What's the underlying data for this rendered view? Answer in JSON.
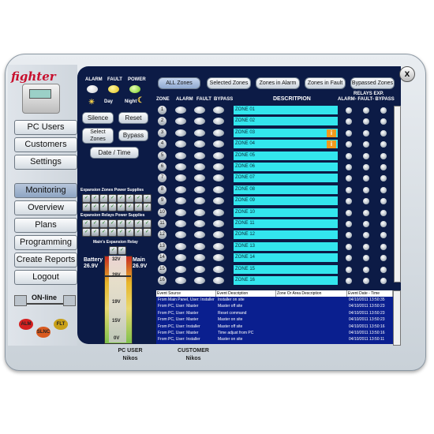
{
  "app": {
    "brand": "fighter",
    "close_label": "x"
  },
  "nav": {
    "items": [
      {
        "label": "PC Users",
        "active": false
      },
      {
        "label": "Customers",
        "active": false
      },
      {
        "label": "Settings",
        "active": false
      },
      {
        "label": "Monitoring",
        "active": true
      },
      {
        "label": "Overview",
        "active": false
      },
      {
        "label": "Plans",
        "active": false
      },
      {
        "label": "Programming",
        "active": false
      },
      {
        "label": "Create Reports",
        "active": false
      },
      {
        "label": "Logout",
        "active": false
      }
    ],
    "online_label": "ON-line"
  },
  "indicators": {
    "alarm": "ALARM",
    "fault": "FAULT",
    "power": "POWER",
    "day": "Day",
    "night": "Night"
  },
  "indicator_colors": {
    "alarm": "#e7e9ee",
    "fault": "#f2d31c",
    "power": "#8cde2c"
  },
  "controls": {
    "silence": "Silence",
    "reset": "Reset",
    "select_zones": "Select Zones",
    "bypass": "Bypass",
    "date_time": "Date / Time"
  },
  "expansion": {
    "zones_label": "Expansion Zones Power Supplies",
    "relays_label": "Expansion Relays Power Supplies",
    "mains_label": "Main's Expansion Relay"
  },
  "battery": {
    "label": "Battery",
    "value": "26.9V"
  },
  "mains": {
    "label": "Main",
    "value": "26.9V"
  },
  "gauge_ticks": [
    "32V",
    "28V",
    "19V",
    "15V",
    "0V"
  ],
  "filters": [
    {
      "label": "ALL Zones",
      "selected": true
    },
    {
      "label": "Selected Zones",
      "selected": false
    },
    {
      "label": "Zones in Alarm",
      "selected": false
    },
    {
      "label": "Zones in Fault",
      "selected": false
    },
    {
      "label": "Bypassed Zones",
      "selected": false
    }
  ],
  "zone_headers": {
    "zone": "ZONE",
    "alarm": "ALARM",
    "fault": "FAULT",
    "bypass": "BYPASS",
    "description": "DESCRITPION",
    "relays_exp": "RELAYS EXP.",
    "relay_cols": "ALARM- FAULT- BYPASS"
  },
  "zones": [
    {
      "num": "1",
      "desc": "ZONE 01",
      "warn": false
    },
    {
      "num": "2",
      "desc": "ZONE 02",
      "warn": false
    },
    {
      "num": "3",
      "desc": "ZONE 03",
      "warn": true
    },
    {
      "num": "4",
      "desc": "ZONE 04",
      "warn": true
    },
    {
      "num": "5",
      "desc": "ZONE 05",
      "warn": false
    },
    {
      "num": "6",
      "desc": "ZONE 06",
      "warn": false
    },
    {
      "num": "7",
      "desc": "ZONE 07",
      "warn": false
    },
    {
      "num": "8",
      "desc": "ZONE 08",
      "warn": false
    },
    {
      "num": "9",
      "desc": "ZONE 09",
      "warn": false
    },
    {
      "num": "10",
      "desc": "ZONE 10",
      "warn": false
    },
    {
      "num": "11",
      "desc": "ZONE 11",
      "warn": false
    },
    {
      "num": "12",
      "desc": "ZONE 12",
      "warn": false
    },
    {
      "num": "13",
      "desc": "ZONE 13",
      "warn": false
    },
    {
      "num": "14",
      "desc": "ZONE 14",
      "warn": false
    },
    {
      "num": "15",
      "desc": "ZONE 15",
      "warn": false
    },
    {
      "num": "16",
      "desc": "ZONE 16",
      "warn": false
    }
  ],
  "warn_glyph": "i",
  "log": {
    "headers": [
      "Event Source",
      "Event Description",
      "Zone Or Area Description",
      "Event Date - Time"
    ],
    "rows": [
      [
        "From Main Panel, User: Installer",
        "Installer on site",
        "",
        "04/10/2011 13:50:35"
      ],
      [
        "From PC, User: Master",
        "Master off site",
        "",
        "04/10/2011 13:50:23"
      ],
      [
        "From PC, User: Master",
        "Reset command",
        "",
        "04/10/2011 13:50:23"
      ],
      [
        "From PC, User: Master",
        "Master on site",
        "",
        "04/10/2011 13:50:23"
      ],
      [
        "From PC, User: Installer",
        "Master off site",
        "",
        "04/10/2011 13:50:16"
      ],
      [
        "From PC, User: Master",
        "Time adjust from PC",
        "",
        "04/10/2011 13:50:16"
      ],
      [
        "From PC, User: Installer",
        "Master on site",
        "",
        "04/10/2011 13:50:11"
      ]
    ]
  },
  "bottom_lamps": [
    {
      "label": "ALM",
      "color": "#d42020"
    },
    {
      "label": "SLNC",
      "color": "#d85a20"
    },
    {
      "label": "FLT",
      "color": "#c8a018"
    }
  ],
  "bottom_tabs": [
    {
      "title": "PC USER",
      "value": "Nikos"
    },
    {
      "title": "CUSTOMER",
      "value": "Nikos"
    }
  ]
}
